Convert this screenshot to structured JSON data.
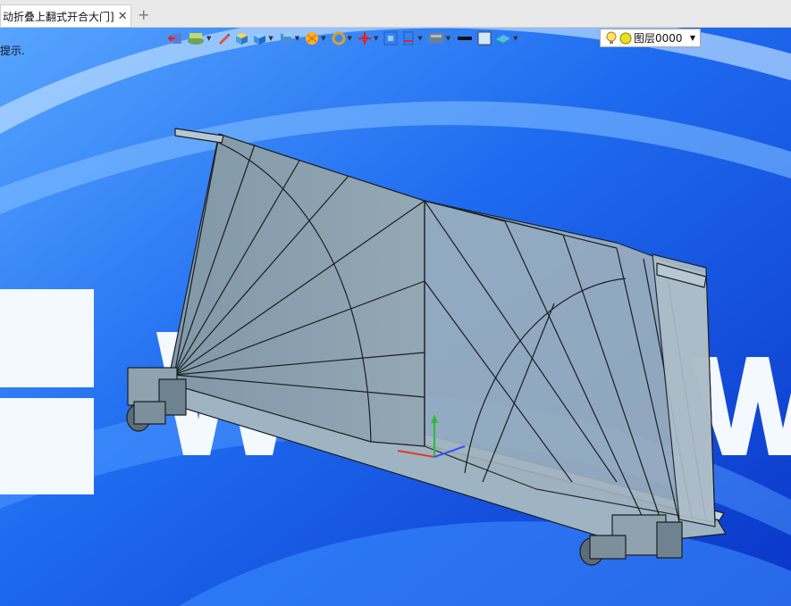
{
  "tab": {
    "title": "动折叠上翻式开合大门]",
    "close": "✕",
    "new_tab": "+"
  },
  "hint": "提示.",
  "toolbar": {
    "layer_name": "图层0000",
    "icons": [
      "exit-sketch-icon",
      "layer-stack-icon",
      "pencil-icon",
      "box-yellow-icon",
      "cube-blue-icon",
      "view-cube-icon",
      "render-ball-icon",
      "zoom-ring-icon",
      "axis-triad-icon",
      "frame-icon",
      "ruler-icon",
      "display-mode-icon",
      "line-color-icon",
      "fill-color-icon",
      "material-icon"
    ]
  },
  "colors": {
    "accent": "#0a3fd0",
    "model_fill": "#8ea3b0",
    "model_edge": "#1a1f24"
  }
}
